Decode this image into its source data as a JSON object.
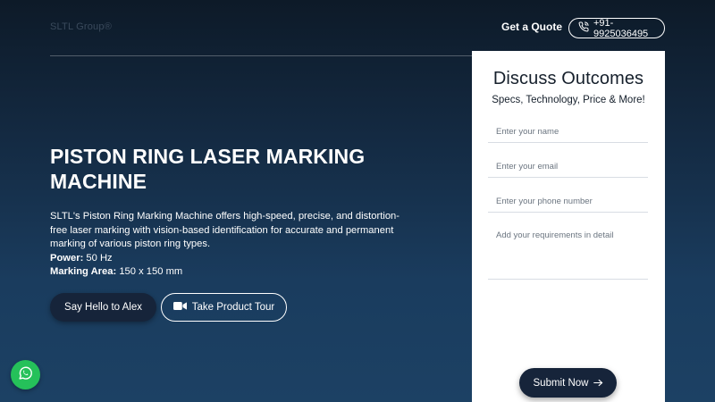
{
  "header": {
    "logo_text": "SLTL Group®",
    "quote_label": "Get a Quote",
    "phone_label": "+91-9925036495"
  },
  "hero": {
    "title": "PISTON RING LASER MARKING MACHINE",
    "description": "SLTL's Piston Ring Marking Machine offers high-speed, precise, and distortion-free laser marking with vision-based identification for accurate and permanent marking of various piston ring types.",
    "specs": [
      {
        "label": "Power:",
        "value": "50 Hz"
      },
      {
        "label": "Marking Area:",
        "value": "150 x 150 mm"
      }
    ],
    "primary_button": "Say Hello to Alex",
    "secondary_button": "Take Product Tour"
  },
  "form": {
    "title": "Discuss Outcomes",
    "subtitle": "Specs, Technology, Price & More!",
    "name_placeholder": "Enter your name",
    "email_placeholder": "Enter your email",
    "phone_placeholder": "Enter your phone number",
    "requirements_placeholder": "Add your requirements in detail",
    "submit_label": "Submit Now"
  },
  "colors": {
    "accent_dark": "#16243a",
    "whatsapp_green": "#25c15a"
  },
  "icons": {
    "phone": "phone-icon",
    "video": "video-camera-icon",
    "arrow": "arrow-right-icon",
    "whatsapp": "whatsapp-icon"
  }
}
